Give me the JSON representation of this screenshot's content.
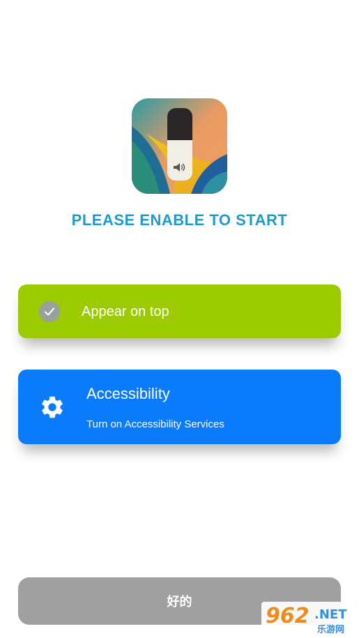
{
  "headline": "PLEASE ENABLE TO START",
  "cards": {
    "overlay": {
      "title": "Appear on top",
      "status": "enabled",
      "color": "#9BCB00"
    },
    "accessibility": {
      "title": "Accessibility",
      "subtitle": "Turn on Accessibility Services",
      "color": "#0A7CFB"
    }
  },
  "ok_button": {
    "label": "好的"
  },
  "watermark": {
    "brand": "962.NET",
    "sub": "乐游网"
  },
  "icons": {
    "app": "volume-slider-app-icon",
    "check": "check-icon",
    "gear": "gear-icon"
  }
}
